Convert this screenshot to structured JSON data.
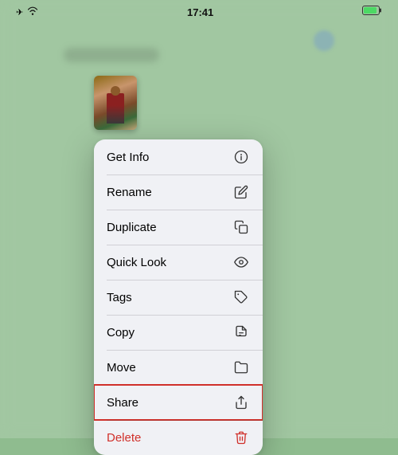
{
  "statusBar": {
    "time": "17:41",
    "icons": {
      "plane": "✈",
      "wifi": "wifi",
      "battery": "battery"
    }
  },
  "thumbnail": {
    "alt": "Photo thumbnail"
  },
  "contextMenu": {
    "items": [
      {
        "id": "get-info",
        "label": "Get Info",
        "icon": "info"
      },
      {
        "id": "rename",
        "label": "Rename",
        "icon": "pencil"
      },
      {
        "id": "duplicate",
        "label": "Duplicate",
        "icon": "duplicate"
      },
      {
        "id": "quick-look",
        "label": "Quick Look",
        "icon": "eye"
      },
      {
        "id": "tags",
        "label": "Tags",
        "icon": "tag"
      },
      {
        "id": "copy",
        "label": "Copy",
        "icon": "copy"
      },
      {
        "id": "move",
        "label": "Move",
        "icon": "folder"
      },
      {
        "id": "share",
        "label": "Share",
        "icon": "share",
        "highlighted": true
      },
      {
        "id": "delete",
        "label": "Delete",
        "icon": "trash",
        "destructive": true
      }
    ]
  }
}
